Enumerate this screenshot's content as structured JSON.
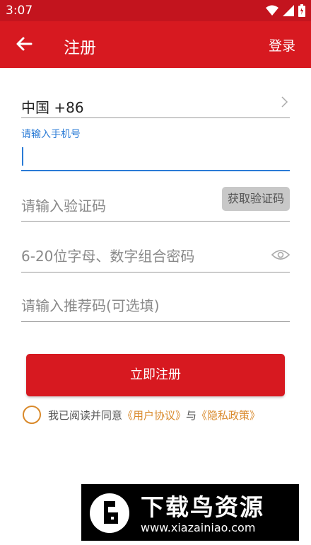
{
  "status_bar": {
    "time": "3:07"
  },
  "app_bar": {
    "title": "注册",
    "login_label": "登录"
  },
  "form": {
    "country_code": "中国 +86",
    "phone_label": "请输入手机号",
    "phone_value": "",
    "code_placeholder": "请输入验证码",
    "get_code_label": "获取验证码",
    "password_placeholder": "6-20位字母、数字组合密码",
    "referral_placeholder": "请输入推荐码(可选填)",
    "submit_label": "立即注册"
  },
  "agreement": {
    "prefix": "我已阅读并同意",
    "user_agreement": "《用户协议》",
    "conjunction": "与",
    "privacy_policy": "《隐私政策》"
  },
  "watermark": {
    "brand": "下载鸟资源",
    "url": "www.xiazainiao.com"
  },
  "colors": {
    "primary": "#d71920",
    "accent_blue": "#2a7bd6",
    "accent_orange": "#d9892a"
  }
}
